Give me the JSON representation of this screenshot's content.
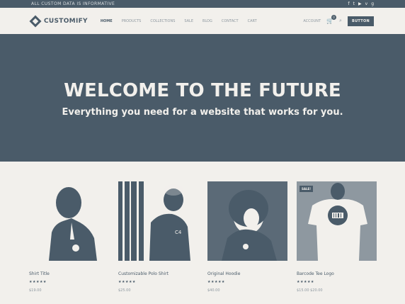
{
  "topbar": {
    "text": "ALL CUSTOM DATA IS INFORMATIVE",
    "social": [
      "f",
      "t",
      "▶",
      "v",
      "g"
    ]
  },
  "header": {
    "logo": "CUSTOMIFY",
    "nav": [
      "HOME",
      "PRODUCTS",
      "COLLECTIONS",
      "SALE",
      "BLOG",
      "CONTACT",
      "CART"
    ],
    "account": "ACCOUNT",
    "cart_count": "0",
    "button": "BUTTON"
  },
  "hero": {
    "title": "WELCOME TO THE FUTURE",
    "subtitle": "Everything you need for a website that works for you."
  },
  "products": [
    {
      "title": "Shirt Title",
      "stars": "★★★★★",
      "price": "$19.00",
      "sale": ""
    },
    {
      "title": "Customizable Polo Shirt",
      "stars": "★★★★★",
      "price": "$25.00",
      "sale": ""
    },
    {
      "title": "Original Hoodie",
      "stars": "★★★★★",
      "price": "$40.00",
      "sale": ""
    },
    {
      "title": "Barcode Tee Logo",
      "stars": "★★★★★",
      "price": "$15.00 $20.00",
      "sale": "SALE!"
    }
  ],
  "colors": {
    "primary": "#4a5b69",
    "background": "#f2f0ec",
    "muted": "#8e98a0"
  }
}
